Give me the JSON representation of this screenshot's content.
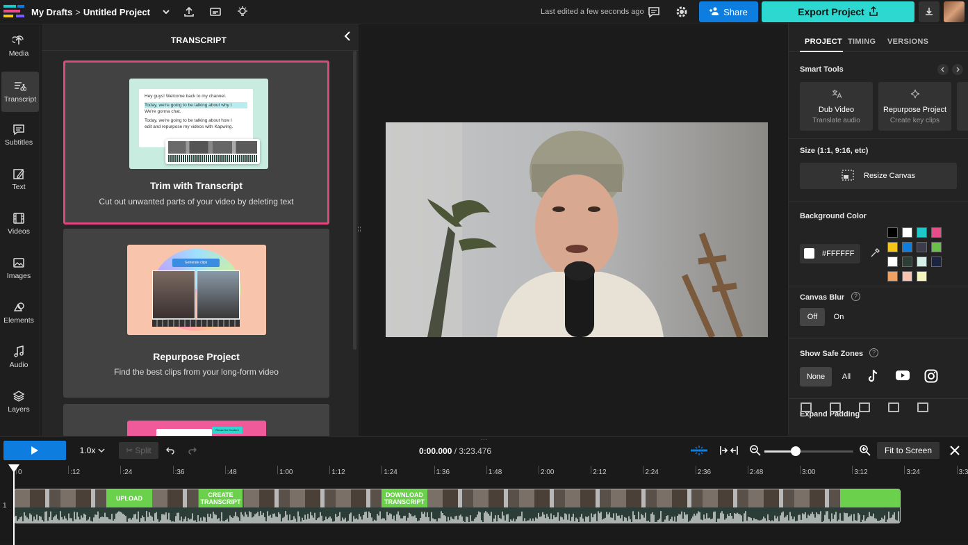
{
  "header": {
    "breadcrumb_root": "My Drafts",
    "breadcrumb_sep": ">",
    "project_name": "Untitled Project",
    "last_edited": "Last edited a few seconds ago",
    "share_label": "Share",
    "export_label": "Export Project"
  },
  "nav": {
    "items": [
      {
        "label": "Media",
        "icon": "upload-icon"
      },
      {
        "label": "Transcript",
        "icon": "transcript-icon"
      },
      {
        "label": "Subtitles",
        "icon": "subtitles-icon"
      },
      {
        "label": "Text",
        "icon": "text-icon"
      },
      {
        "label": "Videos",
        "icon": "film-icon"
      },
      {
        "label": "Images",
        "icon": "image-icon"
      },
      {
        "label": "Elements",
        "icon": "shapes-icon"
      },
      {
        "label": "Audio",
        "icon": "music-icon"
      },
      {
        "label": "Layers",
        "icon": "layers-icon"
      }
    ],
    "active": "Transcript"
  },
  "panel": {
    "title": "TRANSCRIPT",
    "cards": [
      {
        "title": "Trim with Transcript",
        "desc": "Cut out unwanted parts of your video by deleting text",
        "thumb_lines": [
          "Hey guys! Welcome back to my channel.",
          "Today, we're going to be talking about why I",
          "We're gonna chat.",
          "Today, we're going to be talking about how I",
          "edit and repurpose my videos with Kapwing."
        ]
      },
      {
        "title": "Repurpose Project",
        "desc": "Find the best clips from your long-form video",
        "thumb_button": "Generate clips"
      },
      {
        "title": "",
        "desc": "",
        "thumb_tag": "Reuse the Content"
      }
    ]
  },
  "right": {
    "tabs": [
      "PROJECT",
      "TIMING",
      "VERSIONS"
    ],
    "active_tab": "PROJECT",
    "smart_tools_label": "Smart Tools",
    "tools": [
      {
        "title": "Dub Video",
        "sub": "Translate audio",
        "icon": "translate-icon"
      },
      {
        "title": "Repurpose Project",
        "sub": "Create key clips",
        "icon": "sparkle-icon"
      }
    ],
    "size_label": "Size (1:1, 9:16, etc)",
    "resize_label": "Resize Canvas",
    "bg_color_label": "Background Color",
    "bg_color_value": "#FFFFFF",
    "swatches": [
      "#000000",
      "#ffffff",
      "#1fc8c8",
      "#ea4c89",
      "#f5c518",
      "#0e7de0",
      "#3c3c4a",
      "#6bc04b",
      "#ffffff",
      "#2d3e36",
      "#d6f0e8",
      "#1b2440",
      "#f0a060",
      "#f7c2b0",
      "#f5f5c0"
    ],
    "canvas_blur_label": "Canvas Blur",
    "blur_off": "Off",
    "blur_on": "On",
    "safe_zones_label": "Show Safe Zones",
    "safe_none": "None",
    "safe_all": "All",
    "expand_padding_label": "Expand Padding"
  },
  "timeline": {
    "speed": "1.0x",
    "split_label": "Split",
    "current_time": "0:00.000",
    "total_time": "/ 3:23.476",
    "fit_label": "Fit to Screen",
    "ticks": [
      "0",
      ":12",
      ":24",
      ":36",
      ":48",
      "1:00",
      "1:12",
      "1:24",
      "1:36",
      "1:48",
      "2:00",
      "2:12",
      "2:24",
      "2:36",
      "2:48",
      "3:00",
      "3:12",
      "3:24",
      "3:3"
    ],
    "track_number": "1",
    "clip_labels": [
      "UPLOAD",
      "CREATE TRANSCRIPT",
      "DOWNLOAD TRANSCRIPT"
    ],
    "zoom_level": 0.35
  }
}
